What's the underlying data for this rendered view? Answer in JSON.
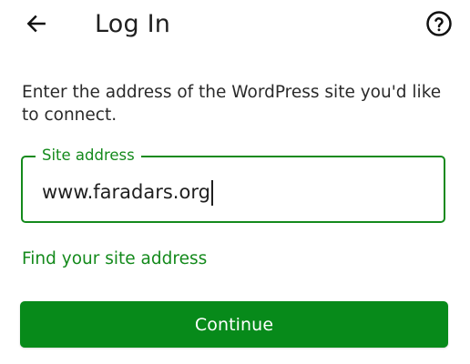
{
  "app_bar": {
    "title": "Log In",
    "back_icon": "arrow-left-icon",
    "help_icon": "help-circle-icon"
  },
  "instruction": "Enter the address of the WordPress site you'd like to connect.",
  "site_field": {
    "label": "Site address",
    "value": "www.faradars.org"
  },
  "find_site_link": "Find your site address",
  "continue_button": "Continue",
  "colors": {
    "accent": "#148a1c",
    "button": "#078a1a",
    "text": "#1f1f1f"
  }
}
